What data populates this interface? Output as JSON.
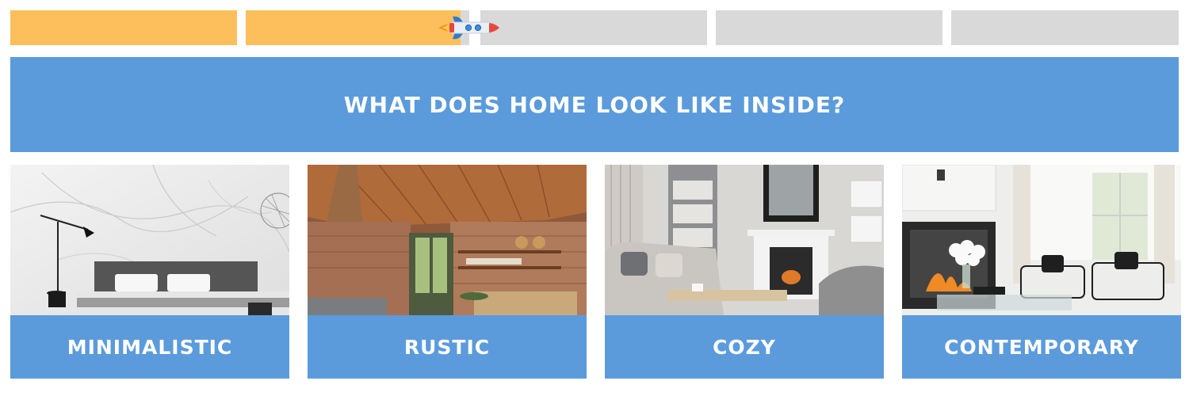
{
  "progress": {
    "total_steps": 5,
    "current_step": 2,
    "current_step_fraction": 0.96,
    "filled_color": "#fdbf5b",
    "empty_color": "#d9d9d9",
    "marker_icon": "rocket-icon"
  },
  "question": {
    "text": "WHAT DOES HOME LOOK LIKE INSIDE?",
    "background": "#5b9bdc"
  },
  "options": [
    {
      "label": "MINIMALISTIC",
      "image": "minimalist-bedroom-photo"
    },
    {
      "label": "RUSTIC",
      "image": "rustic-kitchen-photo"
    },
    {
      "label": "COZY",
      "image": "cozy-living-room-photo"
    },
    {
      "label": "CONTEMPORARY",
      "image": "contemporary-living-room-photo"
    }
  ]
}
